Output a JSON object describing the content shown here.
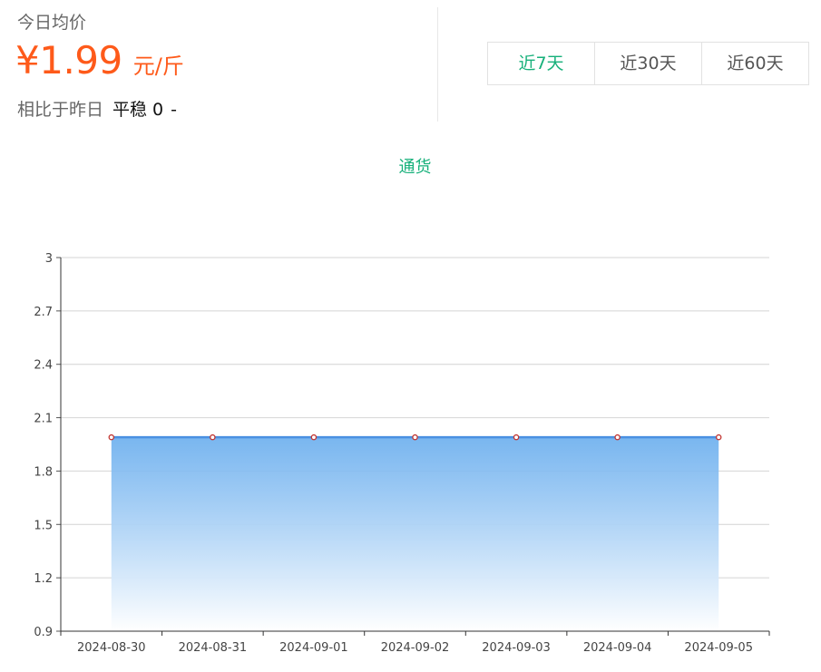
{
  "header": {
    "label": "今日均价",
    "price": "¥1.99",
    "unit": "元/斤",
    "compare_label": "相比于昨日",
    "trend": "平稳",
    "delta": "0",
    "arrow": "-"
  },
  "range_tabs": [
    {
      "label": "近7天",
      "active": true
    },
    {
      "label": "近30天",
      "active": false
    },
    {
      "label": "近60天",
      "active": false
    }
  ],
  "colors": {
    "accent_green": "#16b07a",
    "price_orange": "#fe5a1a",
    "line_blue": "#4a90e2",
    "marker_red": "#c23531"
  },
  "chart_data": {
    "type": "area",
    "title": "通货",
    "categories": [
      "2024-08-30",
      "2024-08-31",
      "2024-09-01",
      "2024-09-02",
      "2024-09-03",
      "2024-09-04",
      "2024-09-05"
    ],
    "series": [
      {
        "values": [
          1.99,
          1.99,
          1.99,
          1.99,
          1.99,
          1.99,
          1.99
        ]
      }
    ],
    "yticks": [
      "0.9",
      "1.2",
      "1.5",
      "1.8",
      "2.1",
      "2.4",
      "2.7",
      "3"
    ],
    "ylim": [
      0.9,
      3
    ],
    "grid": true
  }
}
